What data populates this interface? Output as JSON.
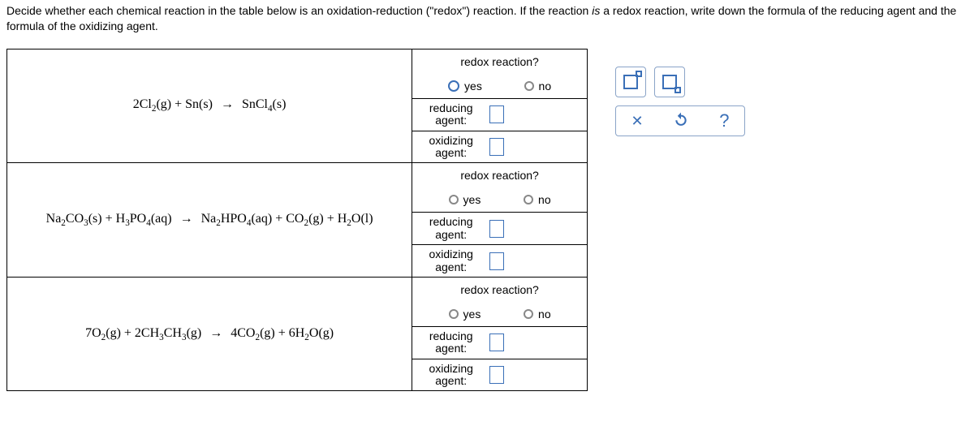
{
  "question": {
    "text_before_em": "Decide whether each chemical reaction in the table below is an oxidation-reduction (\"redox\") reaction. If the reaction ",
    "em": "is",
    "text_after_em": " a redox reaction, write down the formula of the reducing agent and the formula of the oxidizing agent."
  },
  "labels": {
    "redox_q": "redox reaction?",
    "yes": "yes",
    "no": "no",
    "reducing": "reducing agent:",
    "oxidizing": "oxidizing agent:"
  },
  "reactions": [
    {
      "html": "2Cl<span class='sub'>2</span>(g) + Sn(s) <span class='arrow'>→</span> SnCl<span class='sub'>4</span>(s)"
    },
    {
      "html": "Na<span class='sub'>2</span>CO<span class='sub'>3</span>(s) + H<span class='sub'>3</span>PO<span class='sub'>4</span>(aq) <span class='arrow'>→</span> Na<span class='sub'>2</span>HPO<span class='sub'>4</span>(aq) + CO<span class='sub'>2</span>(g) + H<span class='sub'>2</span>O(l)"
    },
    {
      "html": "7O<span class='sub'>2</span>(g) + 2CH<span class='sub'>3</span>CH<span class='sub'>3</span>(g) <span class='arrow'>→</span> 4CO<span class='sub'>2</span>(g) + 6H<span class='sub'>2</span>O(g)"
    }
  ],
  "toolbar": {
    "close": "✕",
    "help": "?"
  }
}
